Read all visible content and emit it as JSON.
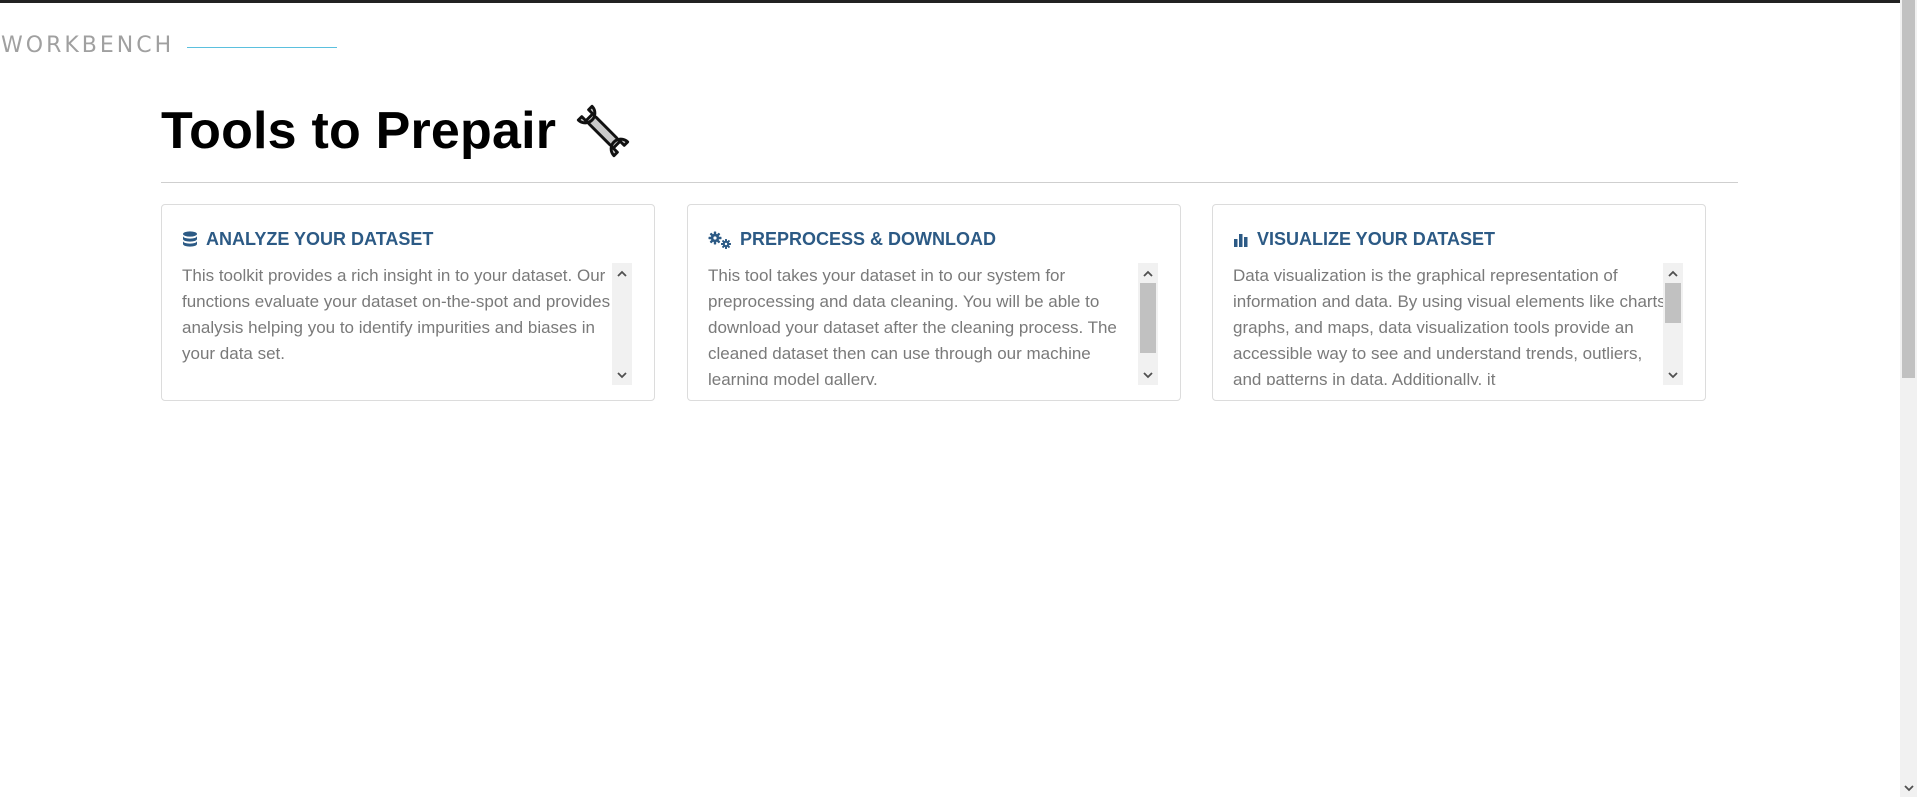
{
  "brand": {
    "label": "WORKBENCH"
  },
  "page": {
    "title": "Tools to Prepair"
  },
  "cards": [
    {
      "icon": "database-icon",
      "title": "ANALYZE YOUR DATASET",
      "body": "This toolkit provides a rich insight in to your dataset. Our functions evaluate your dataset on-the-spot and provides analysis helping you to identify impurities and biases in your data set."
    },
    {
      "icon": "gears-icon",
      "title": "PREPROCESS & DOWNLOAD",
      "body": "This tool takes your dataset in to our system for preprocessing and data cleaning. You will be able to download your dataset after the cleaning process. The cleaned dataset then can use through our machine learning model gallery."
    },
    {
      "icon": "bar-chart-icon",
      "title": "VISUALIZE YOUR DATASET",
      "body": "Data visualization is the graphical representation of information and data. By using visual elements like charts, graphs, and maps, data visualization tools provide an accessible way to see and understand trends, outliers, and patterns in data. Additionally, it"
    }
  ],
  "colors": {
    "accent": "#2c5a85",
    "brand_line": "#5bc0de",
    "body_text": "#7a7a7a"
  }
}
